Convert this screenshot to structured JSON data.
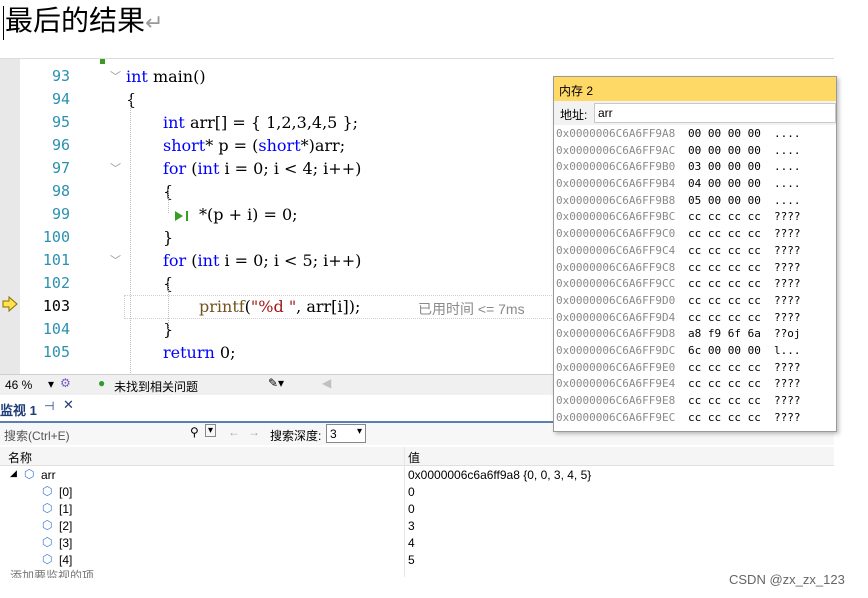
{
  "heading": {
    "title": "最后的结果",
    "return_mark": "↵"
  },
  "editor": {
    "lines": [
      {
        "num": "93",
        "tokens": [
          [
            "kw",
            "int"
          ],
          [
            "t",
            " main()"
          ]
        ]
      },
      {
        "num": "94",
        "tokens": [
          [
            "t",
            "{"
          ]
        ]
      },
      {
        "num": "95",
        "tokens": [
          [
            "kw",
            "int"
          ],
          [
            "t",
            " arr[] = { 1,2,3,4,5 };"
          ]
        ]
      },
      {
        "num": "96",
        "tokens": [
          [
            "kw",
            "short"
          ],
          [
            "t",
            "* p = ("
          ],
          [
            "kw",
            "short"
          ],
          [
            "t",
            "*)arr;"
          ]
        ]
      },
      {
        "num": "97",
        "tokens": [
          [
            "kw",
            "for"
          ],
          [
            "t",
            " ("
          ],
          [
            "kw",
            "int"
          ],
          [
            "t",
            " i = 0; i < 4; i++)"
          ]
        ]
      },
      {
        "num": "98",
        "tokens": [
          [
            "t",
            "{"
          ]
        ]
      },
      {
        "num": "99",
        "tokens": [
          [
            "t",
            "*(p + i) = 0;"
          ]
        ]
      },
      {
        "num": "100",
        "tokens": [
          [
            "t",
            "}"
          ]
        ]
      },
      {
        "num": "101",
        "tokens": [
          [
            "kw",
            "for"
          ],
          [
            "t",
            " ("
          ],
          [
            "kw",
            "int"
          ],
          [
            "t",
            " i = 0; i < 5; i++)"
          ]
        ]
      },
      {
        "num": "102",
        "tokens": [
          [
            "t",
            "{"
          ]
        ]
      },
      {
        "num": "103",
        "tokens": [
          [
            "fn",
            "printf"
          ],
          [
            "t",
            "("
          ],
          [
            "str",
            "\"%d \""
          ],
          [
            "t",
            ", arr[i]);"
          ]
        ]
      },
      {
        "num": "104",
        "tokens": [
          [
            "t",
            "}"
          ]
        ]
      },
      {
        "num": "105",
        "tokens": [
          [
            "kw",
            "return"
          ],
          [
            "t",
            " 0;"
          ]
        ]
      }
    ],
    "elapsed_hint": "已用时间 <= 7ms",
    "current_line": "103"
  },
  "status_strip": {
    "zoom": "46 %",
    "issues": "未找到相关问题"
  },
  "watch": {
    "tab_label": "监视 1",
    "search_placeholder": "搜索(Ctrl+E)",
    "depth_label": "搜索深度:",
    "depth_value": "3",
    "col_name": "名称",
    "col_value": "值",
    "rows": [
      {
        "name": "arr",
        "value": "0x0000006c6a6ff9a8 {0, 0, 3, 4, 5}"
      },
      {
        "name": "[0]",
        "value": "0"
      },
      {
        "name": "[1]",
        "value": "0"
      },
      {
        "name": "[2]",
        "value": "3"
      },
      {
        "name": "[3]",
        "value": "4"
      },
      {
        "name": "[4]",
        "value": "5"
      }
    ],
    "add_item": "添加要监视的项"
  },
  "memory": {
    "title": "内存 2",
    "address_label": "地址:",
    "address_value": "arr",
    "rows": [
      {
        "addr": "0x0000006C6A6FF9A8",
        "bytes": "00 00 00 00",
        "chars": "...."
      },
      {
        "addr": "0x0000006C6A6FF9AC",
        "bytes": "00 00 00 00",
        "chars": "...."
      },
      {
        "addr": "0x0000006C6A6FF9B0",
        "bytes": "03 00 00 00",
        "chars": "...."
      },
      {
        "addr": "0x0000006C6A6FF9B4",
        "bytes": "04 00 00 00",
        "chars": "...."
      },
      {
        "addr": "0x0000006C6A6FF9B8",
        "bytes": "05 00 00 00",
        "chars": "...."
      },
      {
        "addr": "0x0000006C6A6FF9BC",
        "bytes": "cc cc cc cc",
        "chars": "????"
      },
      {
        "addr": "0x0000006C6A6FF9C0",
        "bytes": "cc cc cc cc",
        "chars": "????"
      },
      {
        "addr": "0x0000006C6A6FF9C4",
        "bytes": "cc cc cc cc",
        "chars": "????"
      },
      {
        "addr": "0x0000006C6A6FF9C8",
        "bytes": "cc cc cc cc",
        "chars": "????"
      },
      {
        "addr": "0x0000006C6A6FF9CC",
        "bytes": "cc cc cc cc",
        "chars": "????"
      },
      {
        "addr": "0x0000006C6A6FF9D0",
        "bytes": "cc cc cc cc",
        "chars": "????"
      },
      {
        "addr": "0x0000006C6A6FF9D4",
        "bytes": "cc cc cc cc",
        "chars": "????"
      },
      {
        "addr": "0x0000006C6A6FF9D8",
        "bytes": "a8 f9 6f 6a",
        "chars": "??oj"
      },
      {
        "addr": "0x0000006C6A6FF9DC",
        "bytes": "6c 00 00 00",
        "chars": "l..."
      },
      {
        "addr": "0x0000006C6A6FF9E0",
        "bytes": "cc cc cc cc",
        "chars": "????"
      },
      {
        "addr": "0x0000006C6A6FF9E4",
        "bytes": "cc cc cc cc",
        "chars": "????"
      },
      {
        "addr": "0x0000006C6A6FF9E8",
        "bytes": "cc cc cc cc",
        "chars": "????"
      },
      {
        "addr": "0x0000006C6A6FF9EC",
        "bytes": "cc cc cc cc",
        "chars": "????"
      }
    ]
  },
  "watermark": "CSDN @zx_zx_123",
  "colors": {
    "keyword": "#0000ff",
    "string": "#a31515",
    "line_number": "#2b91af",
    "memory_title": "#ffd966",
    "watch_accent": "#1e3c78"
  }
}
